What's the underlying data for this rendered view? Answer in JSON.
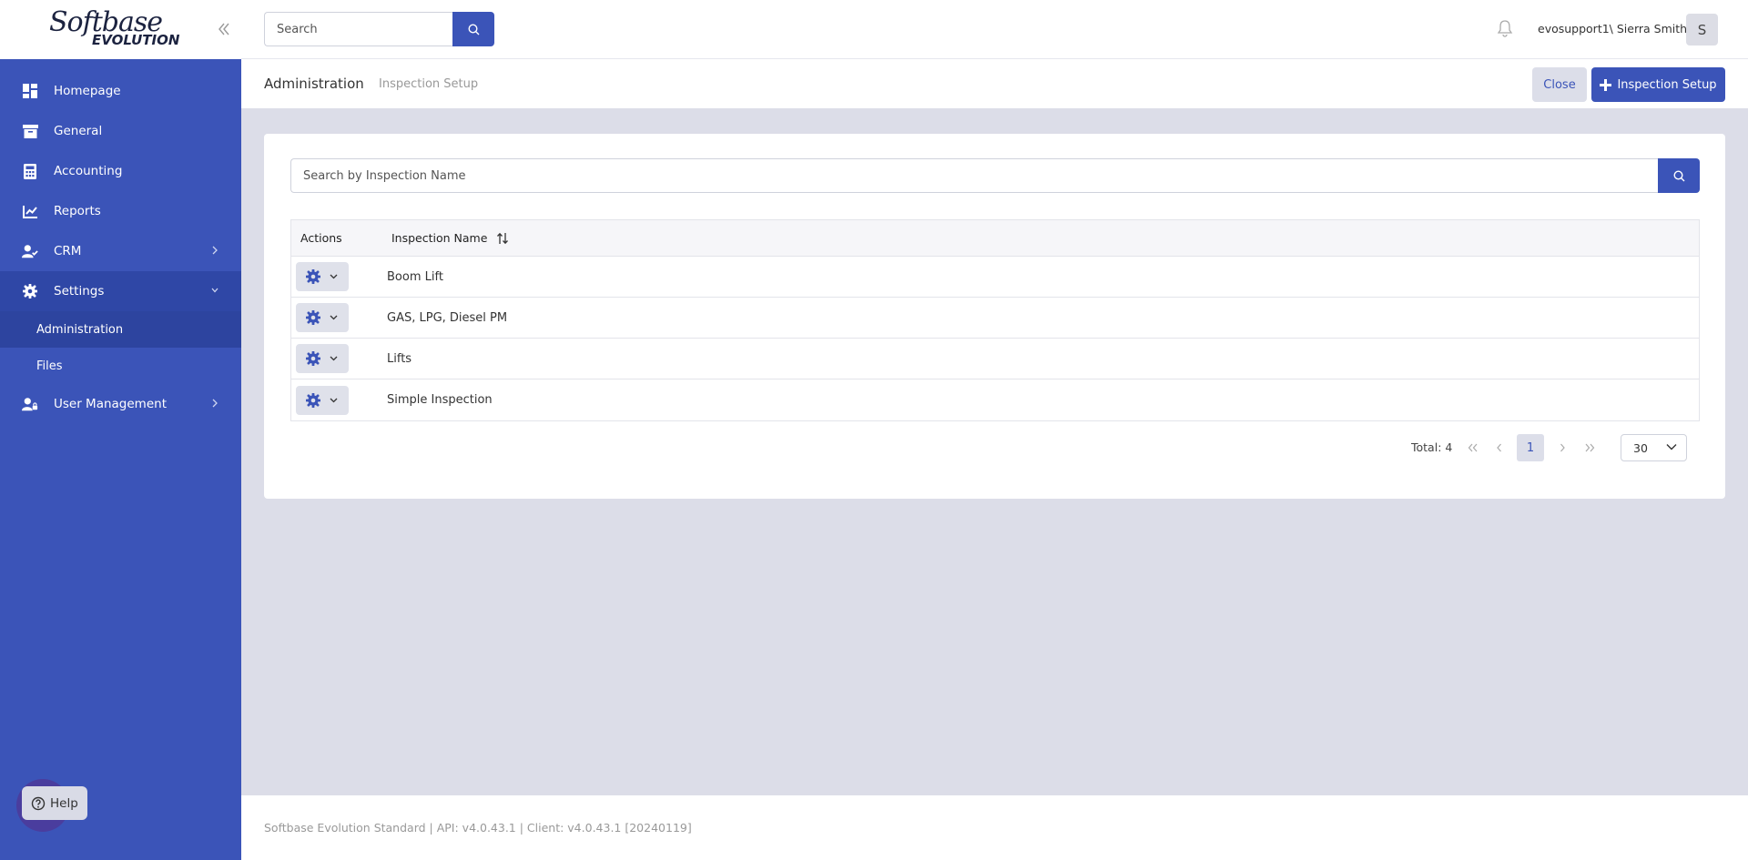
{
  "brand": {
    "logo_line1": "Softbase",
    "logo_line2": "EVOLUTION"
  },
  "sidebar": {
    "items": [
      {
        "label": "Homepage",
        "icon": "dashboard-icon"
      },
      {
        "label": "General",
        "icon": "archive-icon"
      },
      {
        "label": "Accounting",
        "icon": "calculator-icon"
      },
      {
        "label": "Reports",
        "icon": "line-chart-icon"
      },
      {
        "label": "CRM",
        "icon": "users-icon"
      },
      {
        "label": "Settings",
        "icon": "gear-icon"
      },
      {
        "label": "User Management",
        "icon": "user-lock-icon"
      }
    ],
    "settings_sub": [
      {
        "label": "Administration"
      },
      {
        "label": "Files"
      }
    ],
    "help_label": "Help"
  },
  "topbar": {
    "search_placeholder": "Search",
    "user_name": "evosupport1\\ Sierra Smith",
    "avatar_initial": "S"
  },
  "header": {
    "breadcrumb_main": "Administration",
    "breadcrumb_sub": "Inspection Setup",
    "close_label": "Close",
    "add_label": "Inspection Setup"
  },
  "content": {
    "search_placeholder": "Search by Inspection Name",
    "columns": {
      "actions": "Actions",
      "name": "Inspection Name"
    },
    "rows": [
      {
        "name": "Boom Lift"
      },
      {
        "name": "GAS, LPG, Diesel PM"
      },
      {
        "name": "Lifts"
      },
      {
        "name": "Simple Inspection"
      }
    ],
    "pager": {
      "total": "Total: 4",
      "current_page": "1",
      "page_size": "30"
    }
  },
  "footer": {
    "text": "Softbase Evolution Standard | API: v4.0.43.1 | Client: v4.0.43.1 [20240119]"
  },
  "colors": {
    "primary": "#3b54b8",
    "sidebar_active": "#2f47a6",
    "background": "#dcdde8"
  }
}
